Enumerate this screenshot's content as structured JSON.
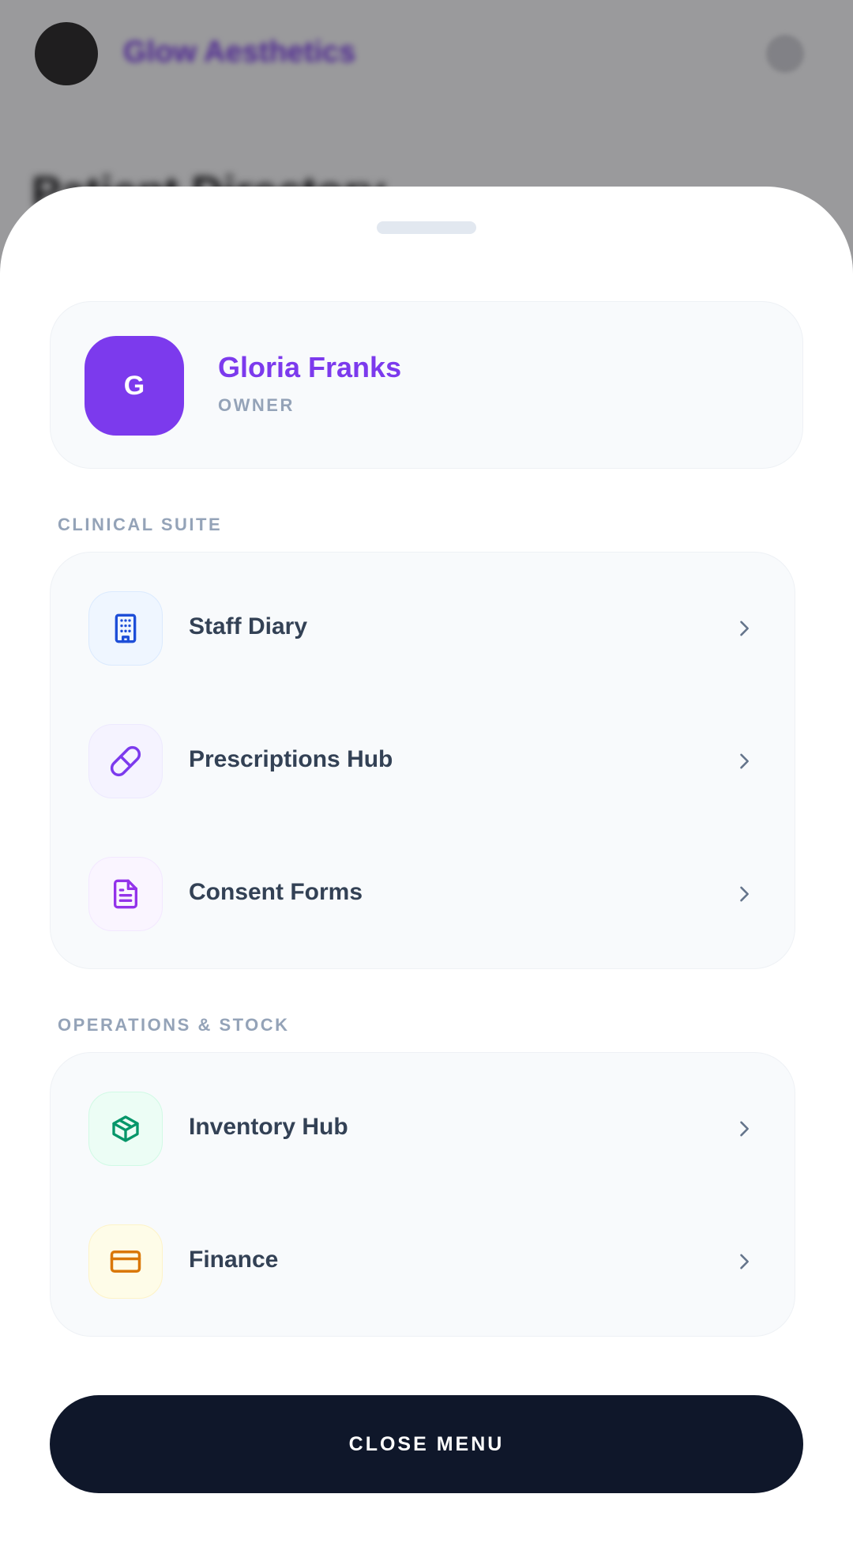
{
  "background": {
    "brand_name": "Glow Aesthetics",
    "page_title": "Patient Directory"
  },
  "profile": {
    "initial": "G",
    "name": "Gloria Franks",
    "role": "OWNER",
    "avatar_color": "#7c3aed"
  },
  "sections": [
    {
      "label": "CLINICAL SUITE",
      "items": [
        {
          "label": "Staff Diary",
          "icon": "building-icon",
          "icon_color": "#1d4ed8",
          "icon_bg": "#eff6ff"
        },
        {
          "label": "Prescriptions Hub",
          "icon": "pill-icon",
          "icon_color": "#7c3aed",
          "icon_bg": "#f5f3ff"
        },
        {
          "label": "Consent Forms",
          "icon": "document-icon",
          "icon_color": "#9333ea",
          "icon_bg": "#faf5ff"
        }
      ]
    },
    {
      "label": "OPERATIONS & STOCK",
      "items": [
        {
          "label": "Inventory Hub",
          "icon": "box-icon",
          "icon_color": "#059669",
          "icon_bg": "#ecfdf5"
        },
        {
          "label": "Finance",
          "icon": "credit-card-icon",
          "icon_color": "#d97706",
          "icon_bg": "#fefce8"
        }
      ]
    }
  ],
  "close_button": {
    "label": "CLOSE MENU",
    "color": "#0f172a"
  }
}
